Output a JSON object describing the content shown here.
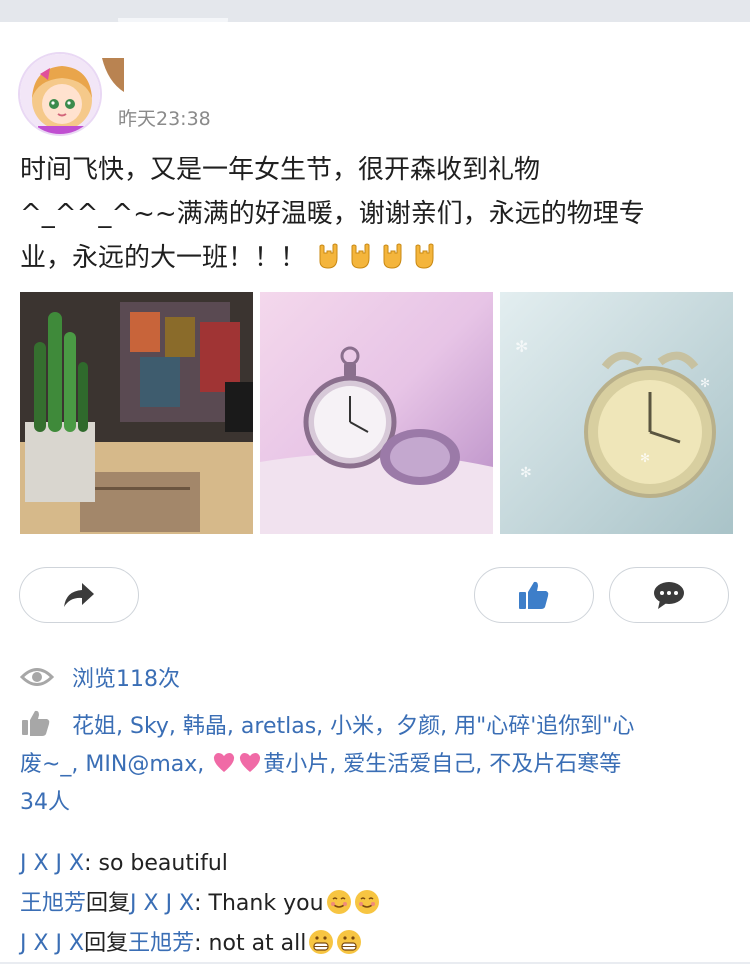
{
  "post": {
    "time": "昨天23:38",
    "text_line1": "时间飞快，又是一年女生节，很开森收到礼物",
    "text_line2": "^_^^_^~~满满的好温暖，谢谢亲们，永远的物理专",
    "text_line3": "业，永远的大一班！！！",
    "emoji_suffix": [
      "rock-hand-icon",
      "rock-hand-icon",
      "rock-hand-icon",
      "rock-hand-icon"
    ]
  },
  "photos": [
    "cactus-desk-photo",
    "pocket-watch-photo",
    "alarm-clock-photo"
  ],
  "actions": {
    "share_icon": "share-arrow-icon",
    "like_icon": "thumbs-up-icon",
    "comment_icon": "speech-bubble-icon"
  },
  "views": {
    "icon": "eye-icon",
    "text": "浏览118次"
  },
  "likes": {
    "icon": "thumbs-up-icon",
    "line1": "花姐, Sky, 韩晶, aretlas, 小米，夕颜, 用\"心碎'追你到\"心",
    "line2_a": "废~_, MIN@max, ",
    "line2_b": "黄小片, 爱生活爱自己, 不及片石寒等",
    "line3": "34人"
  },
  "comments": [
    {
      "name1": "J X J X",
      "sep": ": ",
      "text": "so beautiful"
    },
    {
      "name1": "王旭芳",
      "reply": "回复",
      "name2": "J X J X",
      "sep": ": ",
      "text": "Thank you"
    },
    {
      "name1": "J X J X",
      "reply": "回复",
      "name2": "王旭芳",
      "sep": ": ",
      "text": "not at all"
    }
  ],
  "colors": {
    "link": "#3a6eb5",
    "accent_like": "#3d7ec9",
    "time": "#8a8a8a"
  }
}
